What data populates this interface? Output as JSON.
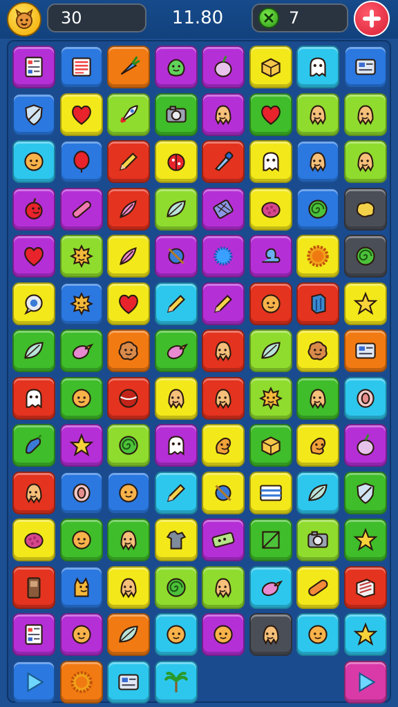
{
  "hud": {
    "score": "30",
    "timer": "11.80",
    "gems": "7"
  },
  "colors": {
    "purple": "#b52fd6",
    "blue": "#2a78e0",
    "orange": "#f27a12",
    "lime": "#8fdc2e",
    "yellow": "#f3e81a",
    "cyan": "#2dc7ee",
    "green": "#3fbd2a",
    "red": "#e4331f",
    "gray": "#4a4e57",
    "pink": "#d93aa8"
  },
  "grid": {
    "rows": [
      [
        [
          "purple",
          "grid-doc"
        ],
        [
          "blue",
          "list-doc"
        ],
        [
          "orange",
          "carrot"
        ],
        [
          "purple",
          "green-blob"
        ],
        [
          "purple",
          "turnip"
        ],
        [
          "yellow",
          "box"
        ],
        [
          "cyan",
          "ghost"
        ],
        [
          "blue",
          "id-card"
        ]
      ],
      [
        [
          "blue",
          "shield"
        ],
        [
          "yellow",
          "heart"
        ],
        [
          "lime",
          "rocket"
        ],
        [
          "green",
          "camera"
        ],
        [
          "purple",
          "octopus"
        ],
        [
          "green",
          "heart"
        ],
        [
          "lime",
          "octopus"
        ],
        [
          "lime",
          "octopus"
        ]
      ],
      [
        [
          "cyan",
          "smiley"
        ],
        [
          "blue",
          "balloon"
        ],
        [
          "red",
          "pencil"
        ],
        [
          "yellow",
          "ladybug"
        ],
        [
          "red",
          "brush"
        ],
        [
          "yellow",
          "ghost"
        ],
        [
          "blue",
          "octopus"
        ],
        [
          "lime",
          "octopus"
        ]
      ],
      [
        [
          "purple",
          "apple"
        ],
        [
          "purple",
          "crayon"
        ],
        [
          "red",
          "feather"
        ],
        [
          "lime",
          "leaf"
        ],
        [
          "purple",
          "net"
        ],
        [
          "yellow",
          "berry"
        ],
        [
          "blue",
          "swirl"
        ],
        [
          "gray",
          "sponge"
        ]
      ],
      [
        [
          "purple",
          "heart"
        ],
        [
          "lime",
          "sun-face"
        ],
        [
          "yellow",
          "feather"
        ],
        [
          "purple",
          "slash-ball"
        ],
        [
          "purple",
          "virus"
        ],
        [
          "purple",
          "snail"
        ],
        [
          "yellow",
          "sunburst"
        ],
        [
          "gray",
          "swirl"
        ]
      ],
      [
        [
          "yellow",
          "chat"
        ],
        [
          "blue",
          "sun-face"
        ],
        [
          "yellow",
          "heart"
        ],
        [
          "cyan",
          "pencil"
        ],
        [
          "purple",
          "pencil"
        ],
        [
          "red",
          "smiley"
        ],
        [
          "red",
          "cube"
        ],
        [
          "yellow",
          "star"
        ]
      ],
      [
        [
          "green",
          "leaf"
        ],
        [
          "green",
          "bird"
        ],
        [
          "orange",
          "cookie"
        ],
        [
          "green",
          "bird"
        ],
        [
          "red",
          "octopus"
        ],
        [
          "lime",
          "leaf"
        ],
        [
          "yellow",
          "cookie"
        ],
        [
          "orange",
          "id-card"
        ]
      ],
      [
        [
          "red",
          "ghost"
        ],
        [
          "green",
          "smiley"
        ],
        [
          "red",
          "ball"
        ],
        [
          "yellow",
          "octopus"
        ],
        [
          "red",
          "octopus"
        ],
        [
          "lime",
          "sun-face"
        ],
        [
          "green",
          "octopus"
        ],
        [
          "cyan",
          "shell"
        ]
      ],
      [
        [
          "green",
          "pepper"
        ],
        [
          "purple",
          "star"
        ],
        [
          "lime",
          "swirl"
        ],
        [
          "purple",
          "ghost"
        ],
        [
          "yellow",
          "squirrel"
        ],
        [
          "green",
          "box"
        ],
        [
          "yellow",
          "squirrel"
        ],
        [
          "purple",
          "turnip"
        ]
      ],
      [
        [
          "red",
          "octopus"
        ],
        [
          "blue",
          "shell"
        ],
        [
          "blue",
          "smiley"
        ],
        [
          "cyan",
          "pencil"
        ],
        [
          "yellow",
          "slash-ball"
        ],
        [
          "yellow",
          "flag"
        ],
        [
          "cyan",
          "leaf"
        ],
        [
          "green",
          "shield"
        ]
      ],
      [
        [
          "yellow",
          "berry"
        ],
        [
          "green",
          "smiley"
        ],
        [
          "green",
          "octopus"
        ],
        [
          "yellow",
          "shirt"
        ],
        [
          "purple",
          "ticket"
        ],
        [
          "green",
          "frame"
        ],
        [
          "lime",
          "camera"
        ],
        [
          "green",
          "star"
        ]
      ],
      [
        [
          "red",
          "door"
        ],
        [
          "blue",
          "cat"
        ],
        [
          "yellow",
          "octopus"
        ],
        [
          "lime",
          "swirl"
        ],
        [
          "lime",
          "octopus"
        ],
        [
          "cyan",
          "bird"
        ],
        [
          "yellow",
          "capsule"
        ],
        [
          "red",
          "crate"
        ]
      ],
      [
        [
          "purple",
          "grid-doc"
        ],
        [
          "purple",
          "smiley"
        ],
        [
          "orange",
          "leaf"
        ],
        [
          "cyan",
          "smiley"
        ],
        [
          "purple",
          "smiley"
        ],
        [
          "gray",
          "octopus"
        ],
        [
          "cyan",
          "smiley"
        ],
        [
          "cyan",
          "star"
        ]
      ],
      [
        [
          "blue",
          "play"
        ],
        [
          "orange",
          "sunburst"
        ],
        [
          "cyan",
          "id-card"
        ],
        [
          "cyan",
          "palm"
        ],
        null,
        null,
        null,
        [
          "pink",
          "play"
        ]
      ]
    ]
  }
}
